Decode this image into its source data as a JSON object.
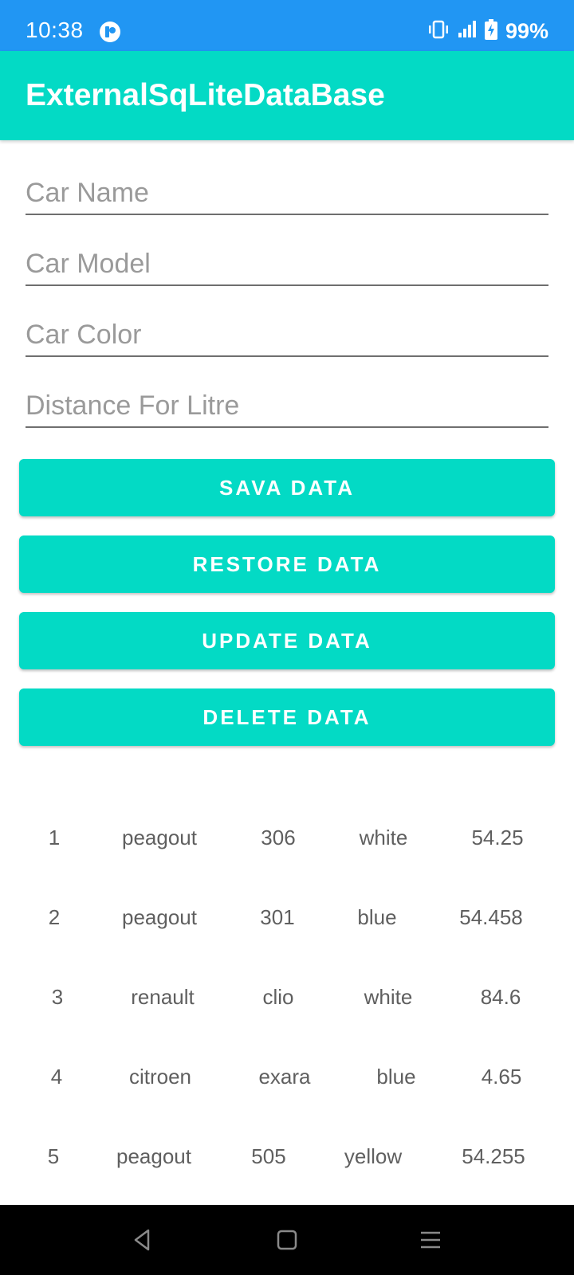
{
  "status_bar": {
    "time": "10:38",
    "battery_percent": "99%",
    "icons": [
      "app-notification-icon",
      "vibrate-icon",
      "signal-icon",
      "battery-charging-icon"
    ]
  },
  "app_bar": {
    "title": "ExternalSqLiteDataBase"
  },
  "form": {
    "car_name_placeholder": "Car Name",
    "car_model_placeholder": "Car Model",
    "car_color_placeholder": "Car Color",
    "distance_placeholder": "Distance For Litre"
  },
  "buttons": {
    "save": "SAVA DATA",
    "restore": "RESTORE DATA",
    "update": "UPDATE DATA",
    "delete": "DELETE DATA"
  },
  "table": {
    "rows": [
      [
        "1",
        "peagout",
        "306",
        "white",
        "54.25"
      ],
      [
        "2",
        "peagout",
        "301",
        "blue",
        "54.458"
      ],
      [
        "3",
        "renault",
        "clio",
        "white",
        "84.6"
      ],
      [
        "4",
        "citroen",
        "exara",
        "blue",
        "4.65"
      ],
      [
        "5",
        "peagout",
        "505",
        "yellow",
        "54.255"
      ]
    ]
  },
  "nav_bar": {
    "icons": [
      "back-icon",
      "home-icon",
      "menu-icon"
    ]
  },
  "colors": {
    "status_bar": "#2196F3",
    "accent": "#03DAC5",
    "nav_bar": "#000000"
  }
}
